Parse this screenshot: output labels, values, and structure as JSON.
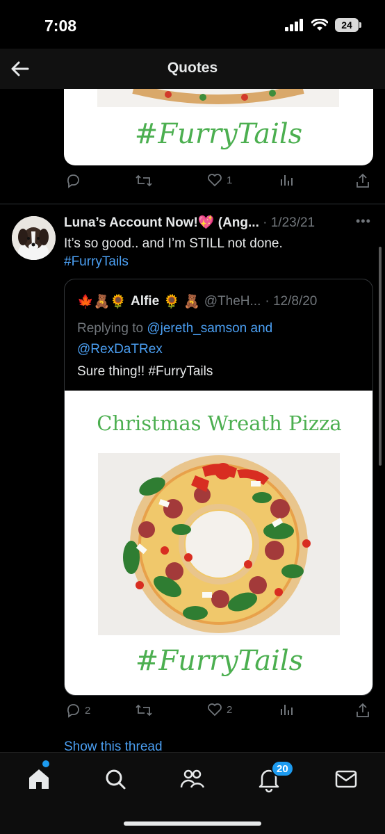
{
  "status": {
    "time": "7:08",
    "battery": "24"
  },
  "header": {
    "title": "Quotes"
  },
  "top_card": {
    "hashtag_image_text": "#FurryTails"
  },
  "top_actions": {
    "reply": "",
    "retweet": "",
    "like": "1",
    "views": ""
  },
  "tweet": {
    "author": "Luna’s Account Now!💖 (Ang...",
    "date": "· 1/23/21",
    "text": "It’s so good.. and I’m STILL not done.",
    "hashtag": "#FurryTails"
  },
  "quote": {
    "emojis": "🍁🧸🌻",
    "name": "Alfie",
    "name_emojis": "🌻 🧸",
    "handle": "@TheH...",
    "date": "· 12/8/20",
    "replying_prefix": "Replying to ",
    "replying_user1": "@jereth_samson",
    "replying_and": " and",
    "replying_user2": "@RexDaTRex",
    "text": "Sure thing!! #FurryTails",
    "image_title": "Christmas Wreath Pizza",
    "image_hashtag": "#FurryTails"
  },
  "bottom_actions": {
    "reply": "2",
    "retweet": "",
    "like": "2",
    "views": ""
  },
  "show_thread": "Show this thread",
  "tabbar": {
    "notifications_badge": "20"
  },
  "colors": {
    "accent": "#1d9bf0",
    "link": "#4b9ff2",
    "hashtag_green": "#4caf50"
  }
}
